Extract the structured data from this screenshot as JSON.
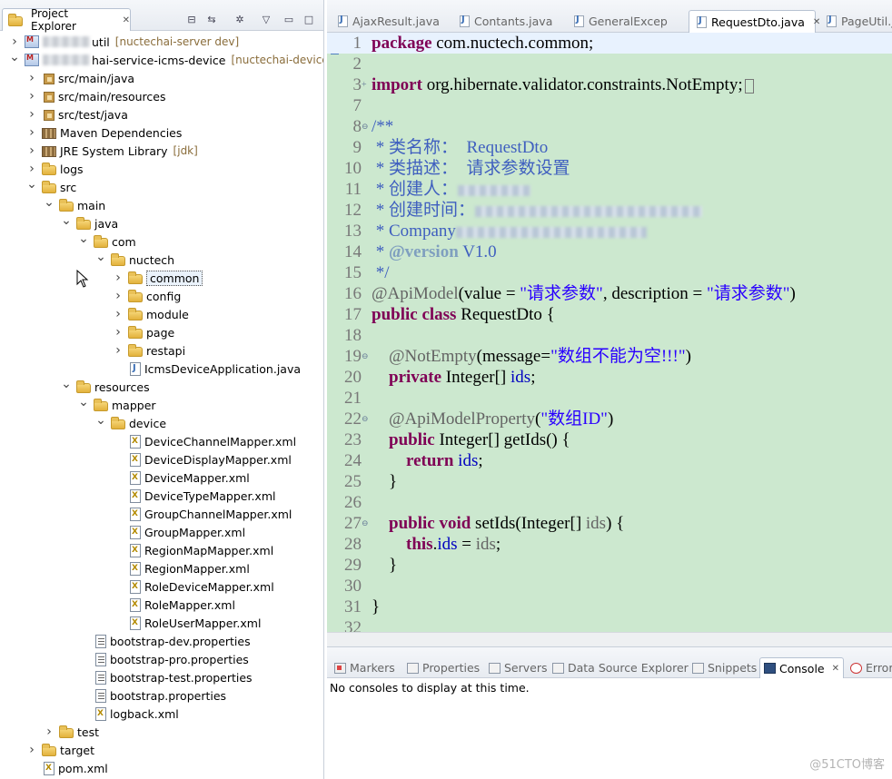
{
  "explorer": {
    "title": "Project Explorer",
    "tree": [
      {
        "label": "util",
        "deco": "[nuctechai-server dev]",
        "icon": "project",
        "twisty": "collapsed",
        "redacted": true
      },
      {
        "label": "hai-service-icms-device",
        "deco": "[nuctechai-device-ser",
        "icon": "project",
        "twisty": "expanded",
        "redacted": true
      },
      {
        "label": "src/main/java",
        "icon": "package-root",
        "twisty": "collapsed"
      },
      {
        "label": "src/main/resources",
        "icon": "package-root",
        "twisty": "collapsed"
      },
      {
        "label": "src/test/java",
        "icon": "package-root",
        "twisty": "collapsed"
      },
      {
        "label": "Maven Dependencies",
        "icon": "library",
        "twisty": "collapsed"
      },
      {
        "label": "JRE System Library",
        "deco": "[jdk]",
        "icon": "library",
        "twisty": "collapsed"
      },
      {
        "label": "logs",
        "icon": "folder",
        "twisty": "collapsed"
      },
      {
        "label": "src",
        "icon": "folder",
        "twisty": "expanded"
      },
      {
        "label": "main",
        "icon": "folder",
        "twisty": "expanded"
      },
      {
        "label": "java",
        "icon": "folder",
        "twisty": "expanded"
      },
      {
        "label": "com",
        "icon": "folder",
        "twisty": "expanded"
      },
      {
        "label": "nuctech",
        "icon": "folder",
        "twisty": "expanded"
      },
      {
        "label": "common",
        "icon": "folder",
        "twisty": "collapsed",
        "selected": true
      },
      {
        "label": "config",
        "icon": "folder",
        "twisty": "collapsed"
      },
      {
        "label": "module",
        "icon": "folder",
        "twisty": "collapsed"
      },
      {
        "label": "page",
        "icon": "folder",
        "twisty": "collapsed"
      },
      {
        "label": "restapi",
        "icon": "folder",
        "twisty": "collapsed"
      },
      {
        "label": "IcmsDeviceApplication.java",
        "icon": "java-file",
        "twisty": "none"
      },
      {
        "label": "resources",
        "icon": "folder",
        "twisty": "expanded"
      },
      {
        "label": "mapper",
        "icon": "folder",
        "twisty": "expanded"
      },
      {
        "label": "device",
        "icon": "folder",
        "twisty": "expanded"
      },
      {
        "label": "DeviceChannelMapper.xml",
        "icon": "xml-file",
        "twisty": "none"
      },
      {
        "label": "DeviceDisplayMapper.xml",
        "icon": "xml-file",
        "twisty": "none"
      },
      {
        "label": "DeviceMapper.xml",
        "icon": "xml-file",
        "twisty": "none"
      },
      {
        "label": "DeviceTypeMapper.xml",
        "icon": "xml-file",
        "twisty": "none"
      },
      {
        "label": "GroupChannelMapper.xml",
        "icon": "xml-file",
        "twisty": "none"
      },
      {
        "label": "GroupMapper.xml",
        "icon": "xml-file",
        "twisty": "none"
      },
      {
        "label": "RegionMapMapper.xml",
        "icon": "xml-file",
        "twisty": "none"
      },
      {
        "label": "RegionMapper.xml",
        "icon": "xml-file",
        "twisty": "none"
      },
      {
        "label": "RoleDeviceMapper.xml",
        "icon": "xml-file",
        "twisty": "none"
      },
      {
        "label": "RoleMapper.xml",
        "icon": "xml-file",
        "twisty": "none"
      },
      {
        "label": "RoleUserMapper.xml",
        "icon": "xml-file",
        "twisty": "none"
      },
      {
        "label": "bootstrap-dev.properties",
        "icon": "properties-file",
        "twisty": "none"
      },
      {
        "label": "bootstrap-pro.properties",
        "icon": "properties-file",
        "twisty": "none"
      },
      {
        "label": "bootstrap-test.properties",
        "icon": "properties-file",
        "twisty": "none"
      },
      {
        "label": "bootstrap.properties",
        "icon": "properties-file",
        "twisty": "none"
      },
      {
        "label": "logback.xml",
        "icon": "xml-file",
        "twisty": "none"
      },
      {
        "label": "test",
        "icon": "folder",
        "twisty": "collapsed"
      },
      {
        "label": "target",
        "icon": "folder",
        "twisty": "collapsed"
      },
      {
        "label": "pom.xml",
        "icon": "xml-file",
        "twisty": "none"
      }
    ]
  },
  "editor": {
    "tabs": [
      {
        "label": "AjaxResult.java",
        "active": false
      },
      {
        "label": "Contants.java",
        "active": false
      },
      {
        "label": "GeneralExcep",
        "active": false
      },
      {
        "label": "RequestDto.java",
        "active": true
      },
      {
        "label": "PageUtil.ja",
        "active": false
      }
    ],
    "lines": [
      {
        "n": "1",
        "tokens": [
          {
            "t": "package",
            "c": "kw"
          },
          {
            "t": " com.nuctech.common;"
          }
        ]
      },
      {
        "n": "2",
        "tokens": []
      },
      {
        "n": "3",
        "fold": "+",
        "tokens": [
          {
            "t": "import",
            "c": "kw"
          },
          {
            "t": " org.hibernate.validator.constraints.NotEmpty;"
          }
        ],
        "folded": true
      },
      {
        "n": "7",
        "tokens": []
      },
      {
        "n": "8",
        "fold": "-",
        "tokens": [
          {
            "t": "/**",
            "c": "cmt"
          }
        ]
      },
      {
        "n": "9",
        "tokens": [
          {
            "t": " * 类名称：  RequestDto",
            "c": "cmt"
          }
        ]
      },
      {
        "n": "10",
        "tokens": [
          {
            "t": " * 类描述：  请求参数设置",
            "c": "cmt"
          }
        ]
      },
      {
        "n": "11",
        "tokens": [
          {
            "t": " * 创建人：",
            "c": "cmt"
          }
        ],
        "redact": 80
      },
      {
        "n": "12",
        "tokens": [
          {
            "t": " * 创建时间：",
            "c": "cmt"
          }
        ],
        "redact": 250
      },
      {
        "n": "13",
        "tokens": [
          {
            "t": " * Company",
            "c": "cmt"
          }
        ],
        "redact": 210
      },
      {
        "n": "14",
        "tokens": [
          {
            "t": " * ",
            "c": "cmt"
          },
          {
            "t": "@version",
            "c": "cmtk"
          },
          {
            "t": " V1.0",
            "c": "cmt"
          }
        ]
      },
      {
        "n": "15",
        "tokens": [
          {
            "t": " */",
            "c": "cmt"
          }
        ]
      },
      {
        "n": "16",
        "tokens": [
          {
            "t": "@ApiModel",
            "c": "ann"
          },
          {
            "t": "(value = "
          },
          {
            "t": "\"请求参数\"",
            "c": "str"
          },
          {
            "t": ", description = "
          },
          {
            "t": "\"请求参数\"",
            "c": "str"
          },
          {
            "t": ")"
          }
        ]
      },
      {
        "n": "17",
        "tokens": [
          {
            "t": "public class",
            "c": "kw"
          },
          {
            "t": " RequestDto {"
          }
        ]
      },
      {
        "n": "18",
        "tokens": []
      },
      {
        "n": "19",
        "fold": "-",
        "tokens": [
          {
            "t": "    "
          },
          {
            "t": "@NotEmpty",
            "c": "ann"
          },
          {
            "t": "(message="
          },
          {
            "t": "\"数组不能为空!!!\"",
            "c": "str"
          },
          {
            "t": ")"
          }
        ]
      },
      {
        "n": "20",
        "tokens": [
          {
            "t": "    "
          },
          {
            "t": "private",
            "c": "kw"
          },
          {
            "t": " Integer[] "
          },
          {
            "t": "ids",
            "c": "fld"
          },
          {
            "t": ";"
          }
        ]
      },
      {
        "n": "21",
        "tokens": []
      },
      {
        "n": "22",
        "fold": "-",
        "tokens": [
          {
            "t": "    "
          },
          {
            "t": "@ApiModelProperty",
            "c": "ann"
          },
          {
            "t": "("
          },
          {
            "t": "\"数组ID\"",
            "c": "str"
          },
          {
            "t": ")"
          }
        ]
      },
      {
        "n": "23",
        "tokens": [
          {
            "t": "    "
          },
          {
            "t": "public",
            "c": "kw"
          },
          {
            "t": " Integer[] getIds() {"
          }
        ]
      },
      {
        "n": "24",
        "tokens": [
          {
            "t": "        "
          },
          {
            "t": "return",
            "c": "kw"
          },
          {
            "t": " "
          },
          {
            "t": "ids",
            "c": "fld"
          },
          {
            "t": ";"
          }
        ]
      },
      {
        "n": "25",
        "tokens": [
          {
            "t": "    }"
          }
        ]
      },
      {
        "n": "26",
        "tokens": []
      },
      {
        "n": "27",
        "fold": "-",
        "tokens": [
          {
            "t": "    "
          },
          {
            "t": "public void",
            "c": "kw"
          },
          {
            "t": " setIds(Integer[] "
          },
          {
            "t": "ids",
            "c": "ann"
          },
          {
            "t": ") {"
          }
        ]
      },
      {
        "n": "28",
        "tokens": [
          {
            "t": "        "
          },
          {
            "t": "this",
            "c": "kw"
          },
          {
            "t": "."
          },
          {
            "t": "ids",
            "c": "fld"
          },
          {
            "t": " = "
          },
          {
            "t": "ids",
            "c": "ann"
          },
          {
            "t": ";"
          }
        ]
      },
      {
        "n": "29",
        "tokens": [
          {
            "t": "    }"
          }
        ]
      },
      {
        "n": "30",
        "tokens": []
      },
      {
        "n": "31",
        "tokens": [
          {
            "t": "}"
          }
        ]
      },
      {
        "n": "32",
        "tokens": []
      }
    ]
  },
  "bottom_panel": {
    "tabs": [
      {
        "label": "Markers",
        "icon": "markers-icon",
        "active": false
      },
      {
        "label": "Properties",
        "icon": "properties-icon",
        "active": false
      },
      {
        "label": "Servers",
        "icon": "servers-icon",
        "active": false
      },
      {
        "label": "Data Source Explorer",
        "icon": "data-source-icon",
        "active": false
      },
      {
        "label": "Snippets",
        "icon": "snippets-icon",
        "active": false
      },
      {
        "label": "Console",
        "icon": "console-icon",
        "active": true
      },
      {
        "label": "Error",
        "icon": "error-log-icon",
        "active": false
      }
    ],
    "console_message": "No consoles to display at this time."
  },
  "watermark": "@51CTO博客",
  "colors": {
    "editor_background": "#cce8cf",
    "keyword": "#7f0055",
    "string": "#2a00ff",
    "comment": "#3f5fbf",
    "field": "#0000c0"
  }
}
